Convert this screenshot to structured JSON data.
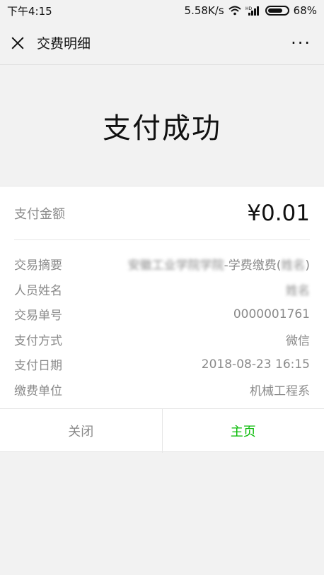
{
  "status": {
    "time": "下午4:15",
    "speed": "5.58K/s",
    "hd": "HD",
    "battery": "68%"
  },
  "nav": {
    "title": "交费明细",
    "more": "···"
  },
  "result": {
    "title": "支付成功"
  },
  "payment": {
    "amount_label": "支付金额",
    "amount_value": "¥0.01",
    "details": [
      {
        "label": "交易摘要",
        "value_blurred_prefix": "安徽工业学院学院",
        "value_mid": "-学费缴费(",
        "value_blurred_suffix": "姓名",
        "value_end": ")"
      },
      {
        "label": "人员姓名",
        "value_blurred": "姓名"
      },
      {
        "label": "交易单号",
        "value": "0000001761"
      },
      {
        "label": "支付方式",
        "value": "微信"
      },
      {
        "label": "支付日期",
        "value": "2018-08-23 16:15"
      },
      {
        "label": "缴费单位",
        "value": "机械工程系"
      }
    ]
  },
  "actions": {
    "close_label": "关闭",
    "home_label": "主页"
  },
  "colors": {
    "accent": "#09bb07",
    "muted": "#8a8a8a",
    "background": "#f2f2f2"
  }
}
